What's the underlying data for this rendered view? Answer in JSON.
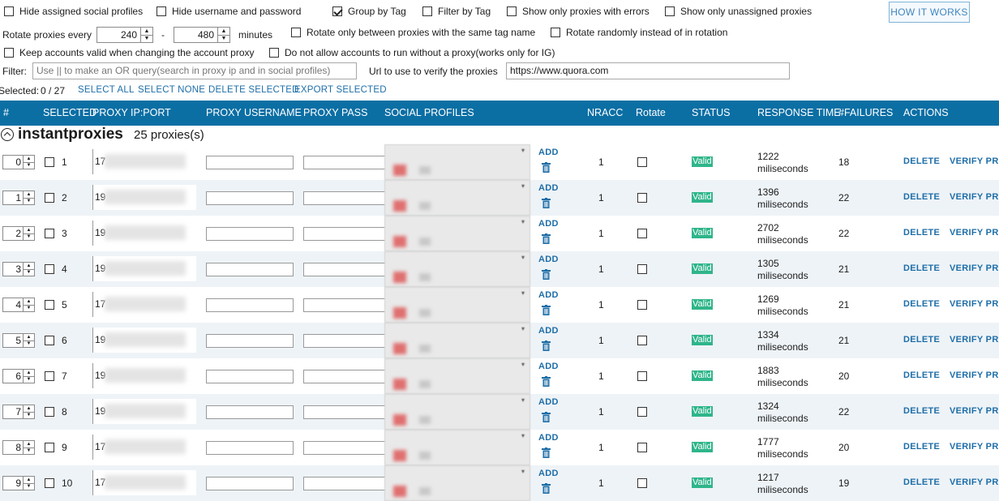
{
  "options": {
    "hide_assigned": {
      "label": "Hide assigned social profiles",
      "checked": false
    },
    "hide_username": {
      "label": "Hide username and password",
      "checked": false
    },
    "group_by_tag": {
      "label": "Group by Tag",
      "checked": true
    },
    "filter_by_tag": {
      "label": "Filter by Tag",
      "checked": false
    },
    "only_errors": {
      "label": "Show only proxies with errors",
      "checked": false
    },
    "only_unassigned": {
      "label": "Show only unassigned proxies",
      "checked": false
    },
    "rotate_same_tag": {
      "label": "Rotate only between proxies with the same tag name",
      "checked": false
    },
    "rotate_random": {
      "label": "Rotate randomly instead of in rotation",
      "checked": false
    },
    "keep_valid": {
      "label": "Keep accounts valid when changing the account proxy",
      "checked": false
    },
    "no_run_without_proxy": {
      "label": "Do not allow accounts to run without a proxy(works only for IG)",
      "checked": false
    }
  },
  "how_it_works": "HOW IT WORKS",
  "rotate": {
    "label": "Rotate proxies every",
    "min": "240",
    "dash": "-",
    "max": "480",
    "unit": "minutes"
  },
  "filter": {
    "label": "Filter:",
    "placeholder": "Use || to make an OR query(search in proxy ip and in social profiles)"
  },
  "verify_url": {
    "label": "Url to use to verify the proxies",
    "value": "https://www.quora.com"
  },
  "selection": {
    "label": "Selected:",
    "count": "0 / 27",
    "select_all": "SELECT ALL",
    "select_none": "SELECT NONE",
    "delete_selected": "DELETE SELECTED",
    "export_selected": "EXPORT SELECTED"
  },
  "columns": {
    "num": "#",
    "selected": "SELECTED",
    "ip_port": "PROXY IP:PORT",
    "username": "PROXY USERNAME",
    "pass": "PROXY PASS",
    "social": "SOCIAL PROFILES",
    "nracc": "NRACC",
    "rotate": "Rotate",
    "status": "STATUS",
    "response": "RESPONSE TIME",
    "failures": "#FAILURES",
    "actions": "ACTIONS"
  },
  "group": {
    "name": "instantproxies",
    "count": "25 proxies(s)"
  },
  "row_labels": {
    "add": "ADD",
    "delete": "DELETE",
    "verify": "VERIFY PRO",
    "ms_unit": "miliseconds"
  },
  "rows": [
    {
      "order": "0",
      "index": "1",
      "ip_prefix": "17",
      "nracc": "1",
      "status": "Valid",
      "response": "1222",
      "failures": "18"
    },
    {
      "order": "1",
      "index": "2",
      "ip_prefix": "19",
      "nracc": "1",
      "status": "Valid",
      "response": "1396",
      "failures": "22"
    },
    {
      "order": "2",
      "index": "3",
      "ip_prefix": "19",
      "nracc": "1",
      "status": "Valid",
      "response": "2702",
      "failures": "22"
    },
    {
      "order": "3",
      "index": "4",
      "ip_prefix": "19",
      "nracc": "1",
      "status": "Valid",
      "response": "1305",
      "failures": "21"
    },
    {
      "order": "4",
      "index": "5",
      "ip_prefix": "17",
      "nracc": "1",
      "status": "Valid",
      "response": "1269",
      "failures": "21"
    },
    {
      "order": "5",
      "index": "6",
      "ip_prefix": "19",
      "nracc": "1",
      "status": "Valid",
      "response": "1334",
      "failures": "21"
    },
    {
      "order": "6",
      "index": "7",
      "ip_prefix": "19",
      "nracc": "1",
      "status": "Valid",
      "response": "1883",
      "failures": "20"
    },
    {
      "order": "7",
      "index": "8",
      "ip_prefix": "19",
      "nracc": "1",
      "status": "Valid",
      "response": "1324",
      "failures": "22"
    },
    {
      "order": "8",
      "index": "9",
      "ip_prefix": "17",
      "nracc": "1",
      "status": "Valid",
      "response": "1777",
      "failures": "20"
    },
    {
      "order": "9",
      "index": "10",
      "ip_prefix": "17",
      "nracc": "1",
      "status": "Valid",
      "response": "1217",
      "failures": "19"
    }
  ],
  "colors": {
    "header": "#0b6fa4",
    "link": "#1e6ea8",
    "valid": "#2fb58a",
    "alt_row": "#eef3f7"
  }
}
